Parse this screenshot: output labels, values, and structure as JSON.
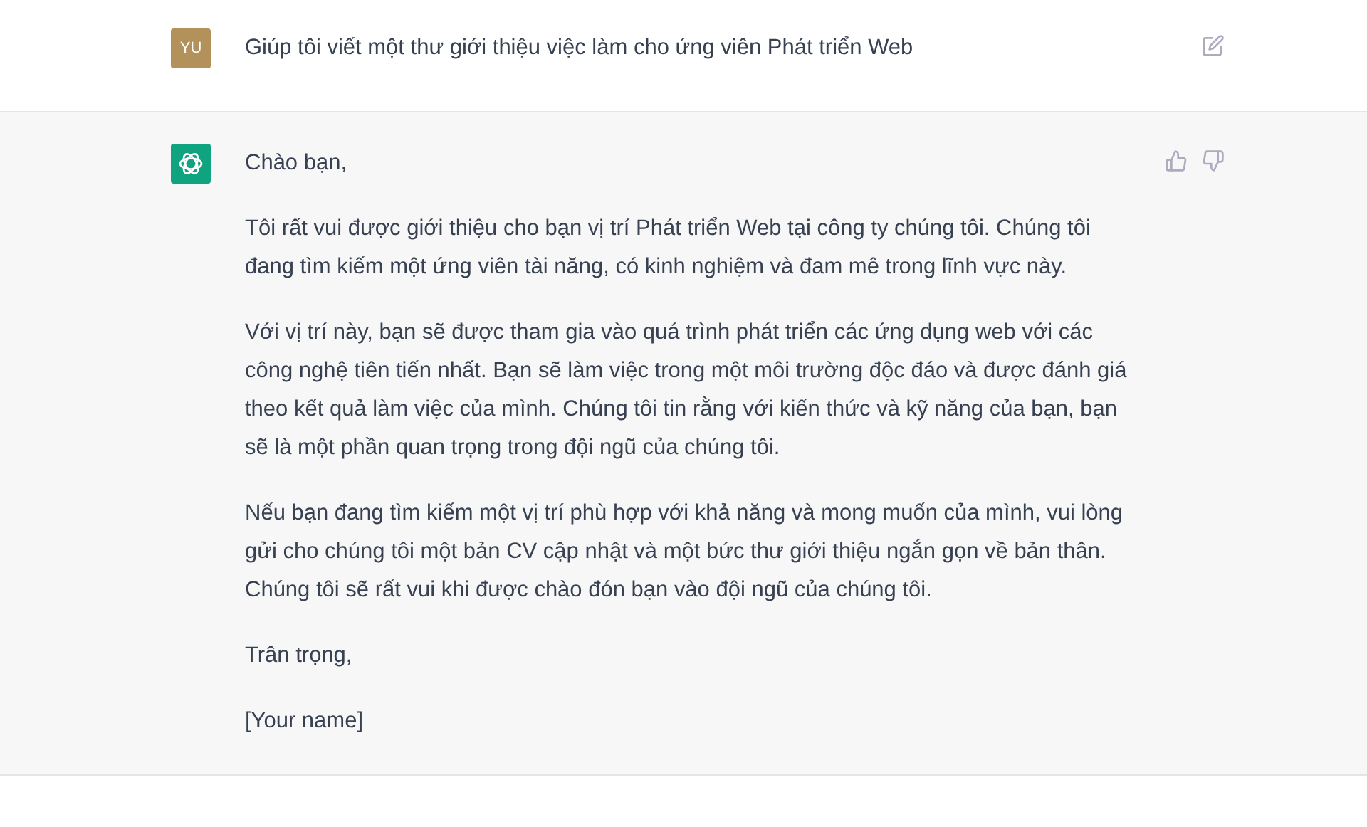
{
  "messages": [
    {
      "kind": "user",
      "avatar": "YU",
      "paragraphs": [
        "Giúp tôi viết một thư giới thiệu việc làm cho ứng viên Phát triển Web"
      ]
    },
    {
      "kind": "assistant",
      "paragraphs": [
        "Chào bạn,",
        "Tôi rất vui được giới thiệu cho bạn vị trí Phát triển Web tại công ty chúng tôi. Chúng tôi đang tìm kiếm một ứng viên tài năng, có kinh nghiệm và đam mê trong lĩnh vực này.",
        "Với vị trí này, bạn sẽ được tham gia vào quá trình phát triển các ứng dụng web với các công nghệ tiên tiến nhất. Bạn sẽ làm việc trong một môi trường độc đáo và được đánh giá theo kết quả làm việc của mình. Chúng tôi tin rằng với kiến thức và kỹ năng của bạn, bạn sẽ là một phần quan trọng trong đội ngũ của chúng tôi.",
        "Nếu bạn đang tìm kiếm một vị trí phù hợp với khả năng và mong muốn của mình, vui lòng gửi cho chúng tôi một bản CV cập nhật và một bức thư giới thiệu ngắn gọn về bản thân. Chúng tôi sẽ rất vui khi được chào đón bạn vào đội ngũ của chúng tôi.",
        "Trân trọng,",
        "[Your name]"
      ]
    }
  ]
}
